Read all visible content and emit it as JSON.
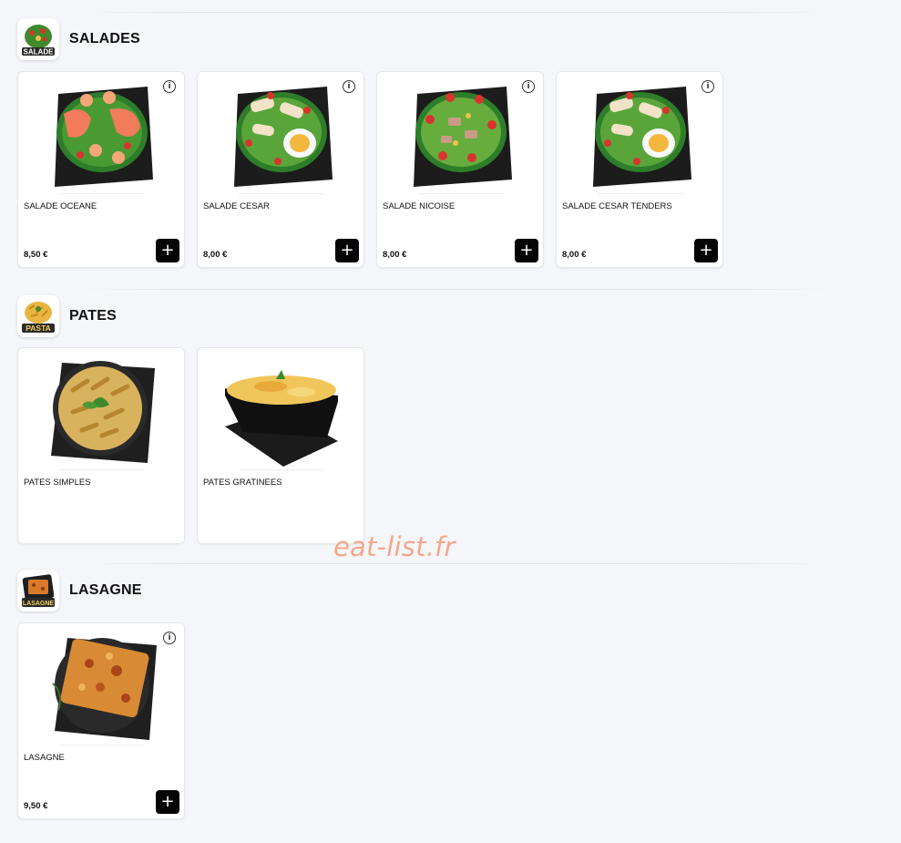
{
  "sections": [
    {
      "title": "SALADES",
      "thumb_label": "SALADE",
      "icon": "salad-icon",
      "items": [
        {
          "name": "SALADE OCEANE",
          "price": "8,50 €",
          "add_label": "+",
          "info_label": "i",
          "image": "salmon-shrimp-salad"
        },
        {
          "name": "SALADE CESAR",
          "price": "8,00 €",
          "add_label": "+",
          "info_label": "i",
          "image": "caesar-salad"
        },
        {
          "name": "SALADE NICOISE",
          "price": "8,00 €",
          "add_label": "+",
          "info_label": "i",
          "image": "nicoise-salad"
        },
        {
          "name": "SALADE CESAR TENDERS",
          "price": "8,00 €",
          "add_label": "+",
          "info_label": "i",
          "image": "caesar-tenders-salad"
        }
      ]
    },
    {
      "title": "PATES",
      "thumb_label": "PASTA",
      "icon": "pasta-icon",
      "items": [
        {
          "name": "PATES SIMPLES",
          "image": "penne-pasta"
        },
        {
          "name": "PATES GRATINEES",
          "image": "gratin-pasta-tray"
        }
      ]
    },
    {
      "title": "LASAGNE",
      "thumb_label": "LASAGNE",
      "icon": "lasagne-icon",
      "items": [
        {
          "name": "LASAGNE",
          "price": "9,50 €",
          "add_label": "+",
          "info_label": "i",
          "image": "lasagne-plate"
        }
      ]
    }
  ],
  "watermark": "eat-list.fr",
  "colors": {
    "background": "#f5f6f9",
    "card": "#ffffff",
    "button": "#050505",
    "watermark": "#f4a889"
  }
}
